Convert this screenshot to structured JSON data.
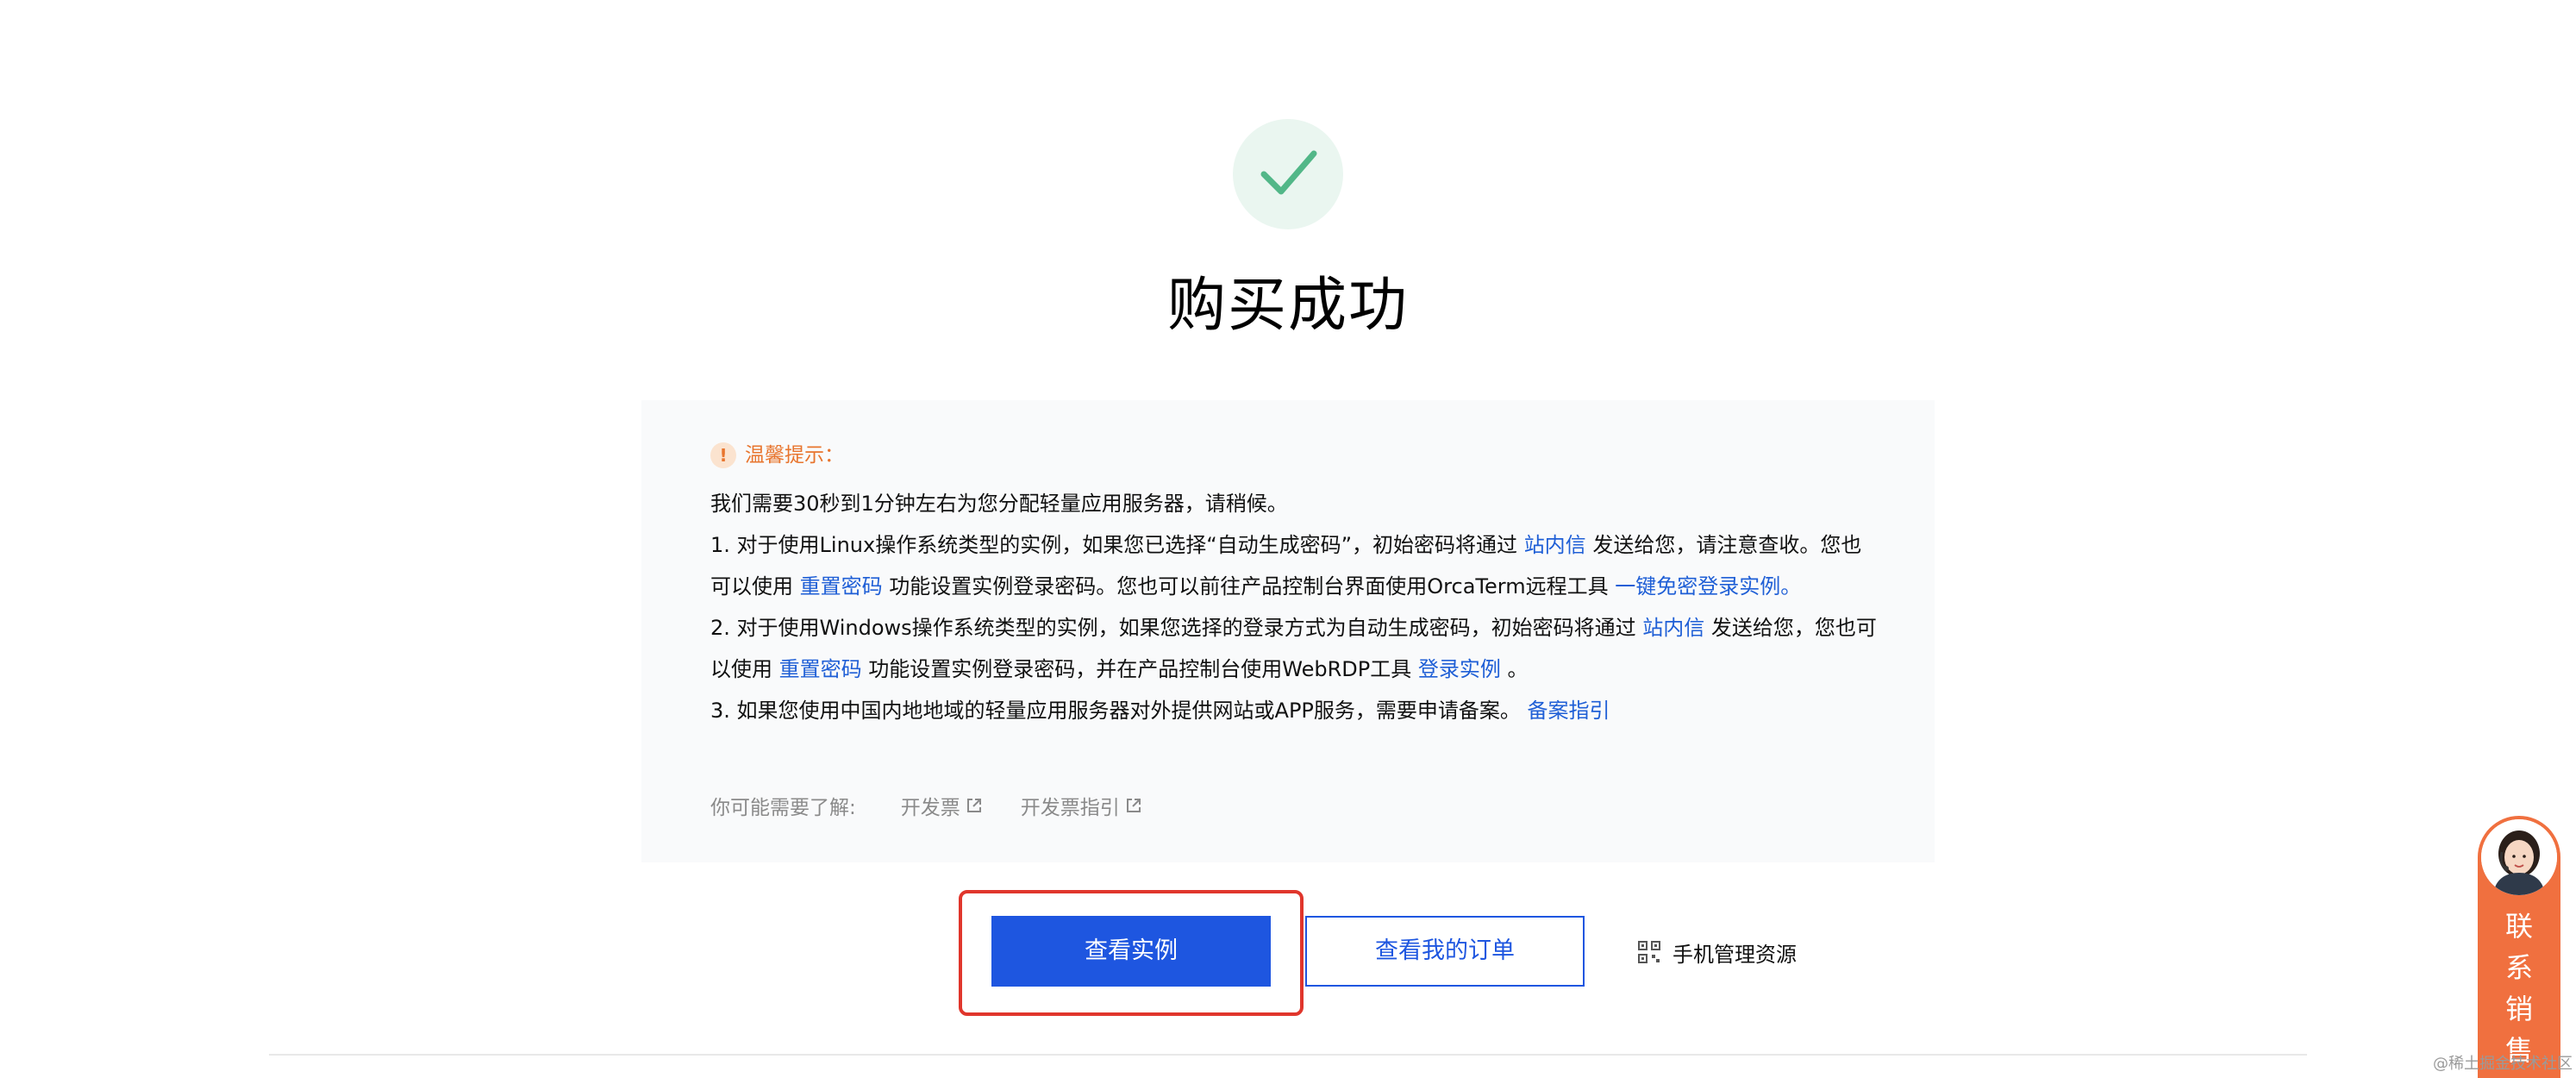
{
  "colors": {
    "success": "#52b788",
    "warning": "#e8752e",
    "link": "#1f5fd6",
    "primary": "#1e56e0",
    "highlight": "#e0362c",
    "contact": "#f0703f"
  },
  "icons": {
    "success": "check-icon",
    "warning": "exclamation-icon",
    "external": "external-link-icon",
    "qr": "qr-code-icon"
  },
  "page": {
    "title": "购买成功"
  },
  "tip": {
    "title": "温馨提示：",
    "line0": "我们需要30秒到1分钟左右为您分配轻量应用服务器，请稍候。",
    "line1": {
      "text_a": "1. 对于使用Linux操作系统类型的实例，如果您已选择“自动生成密码”，初始密码将通过 ",
      "link_a": "站内信",
      "text_b": " 发送给您，请注意查收。您也"
    },
    "line2": {
      "text_a": "可以使用 ",
      "link_a": "重置密码",
      "text_b": " 功能设置实例登录密码。您也可以前往产品控制台界面使用OrcaTerm远程工具 ",
      "link_b": "一键免密登录实例。"
    },
    "line3": {
      "text_a": "2. 对于使用Windows操作系统类型的实例，如果您选择的登录方式为自动生成密码，初始密码将通过 ",
      "link_a": "站内信",
      "text_b": " 发送给您，您也可"
    },
    "line4": {
      "text_a": "以使用 ",
      "link_a": "重置密码",
      "text_b": " 功能设置实例登录密码，并在产品控制台使用WebRDP工具 ",
      "link_b": "登录实例",
      "text_c": " 。"
    },
    "line5": {
      "text_a": "3. 如果您使用中国内地地域的轻量应用服务器对外提供网站或APP服务，需要申请备案。 ",
      "link_a": "备案指引"
    },
    "learn_more": {
      "label": "你可能需要了解:",
      "links": [
        "开发票",
        "开发票指引"
      ]
    }
  },
  "actions": {
    "view_instance": "查看实例",
    "view_orders": "查看我的订单",
    "mobile_manage": "手机管理资源"
  },
  "contact": {
    "chars": [
      "联",
      "系",
      "销",
      "售"
    ]
  },
  "watermark": "@稀土掘金技术社区"
}
